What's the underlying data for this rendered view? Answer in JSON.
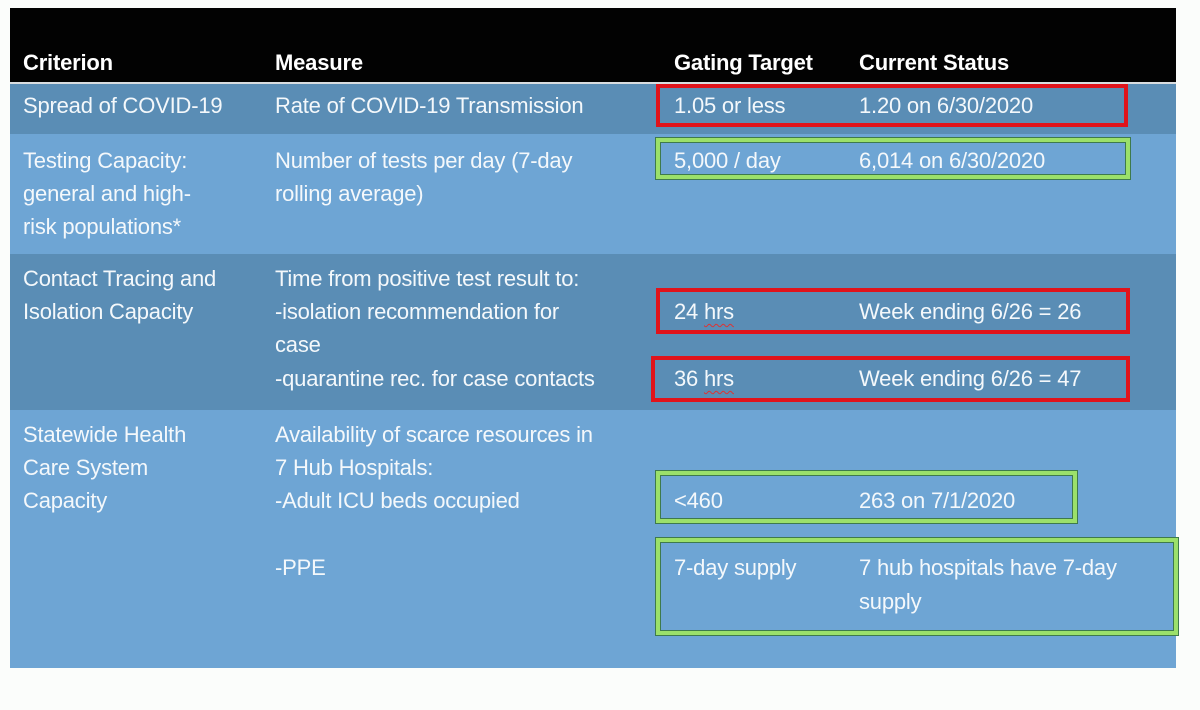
{
  "table": {
    "headers": {
      "criterion": "Criterion",
      "measure": "Measure",
      "gating_target": "Gating Target",
      "current_status": "Current Status"
    },
    "rows": [
      {
        "criterion": [
          "Spread of COVID-19"
        ],
        "measure": [
          "Rate of COVID-19 Transmission"
        ],
        "items": [
          {
            "target": "1.05 or less",
            "status": [
              "1.20 on 6/30/2020"
            ],
            "highlight": "red"
          }
        ]
      },
      {
        "criterion": [
          "Testing Capacity:",
          "general and high-",
          "risk populations*"
        ],
        "measure": [
          "Number of tests per day (7-day",
          "rolling average)"
        ],
        "items": [
          {
            "target": "5,000 / day",
            "status": [
              "6,014 on 6/30/2020"
            ],
            "highlight": "green"
          }
        ]
      },
      {
        "criterion": [
          "Contact Tracing and",
          "Isolation Capacity"
        ],
        "measure": [
          "Time from positive test result to:",
          "-isolation recommendation for",
          "case",
          "-quarantine rec. for case contacts"
        ],
        "items": [
          {
            "target_num": "24",
            "target_unit": "hrs",
            "status": [
              "Week ending 6/26 = 26"
            ],
            "highlight": "red"
          },
          {
            "target_num": "36",
            "target_unit": "hrs",
            "status": [
              "Week ending 6/26 = 47"
            ],
            "highlight": "red"
          }
        ]
      },
      {
        "criterion": [
          "Statewide Health",
          "Care System",
          "Capacity"
        ],
        "measure": [
          "Availability of scarce resources in",
          "7 Hub Hospitals:",
          "-Adult ICU beds occupied",
          "-PPE"
        ],
        "items": [
          {
            "target": "<460",
            "status": [
              "263 on 7/1/2020"
            ],
            "highlight": "green"
          },
          {
            "target": "7-day supply",
            "status": [
              "7 hub hospitals have 7-day",
              "supply"
            ],
            "highlight": "green"
          }
        ]
      }
    ],
    "colors": {
      "header_bg": "#020202",
      "row_dark": "#5a8db5",
      "row_light": "#6ea5d4",
      "highlight_red": "#e0131b",
      "highlight_green": "#9be06a"
    }
  }
}
